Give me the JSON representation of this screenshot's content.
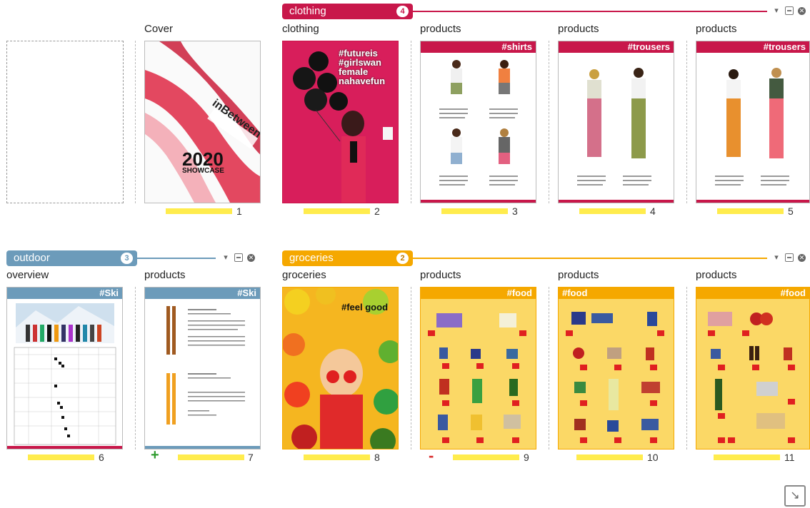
{
  "groups": {
    "clothing": {
      "label": "clothing",
      "count": "4",
      "color": "#c8174a"
    },
    "outdoor": {
      "label": "outdoor",
      "count": "3",
      "color": "#6c9bba"
    },
    "groceries": {
      "label": "groceries",
      "count": "2",
      "color": "#f5a800"
    }
  },
  "labels": {
    "cover": "Cover",
    "clothing": "clothing",
    "products3": "products",
    "products4": "products",
    "products5": "products",
    "overview": "overview",
    "products7": "products",
    "groceries": "groceries",
    "products9": "products",
    "products10": "products",
    "products11": "products"
  },
  "pages": {
    "p1": {
      "number": "1",
      "brand": "inBetween",
      "year": "2020",
      "subtitle": "SHOWCASE"
    },
    "p2": {
      "number": "2",
      "hashtags": "#futureis #girlswan female nahavefun"
    },
    "p3": {
      "number": "3",
      "tag": "#shirts"
    },
    "p4": {
      "number": "4",
      "tag": "#trousers"
    },
    "p5": {
      "number": "5",
      "tag": "#trousers"
    },
    "p6": {
      "number": "6",
      "tag": "#Ski"
    },
    "p7": {
      "number": "7",
      "tag": "#Ski"
    },
    "p8": {
      "number": "8",
      "hashtag": "#feel good"
    },
    "p9": {
      "number": "9",
      "tag": "#food"
    },
    "p10": {
      "number": "10",
      "tag": "#food"
    },
    "p11": {
      "number": "11",
      "tag": "#food"
    }
  },
  "controls": {
    "plus": "+",
    "minus": "-"
  },
  "icons": [
    "paint-bucket-icon",
    "collapse-icon",
    "close-icon",
    "expand-icon"
  ]
}
